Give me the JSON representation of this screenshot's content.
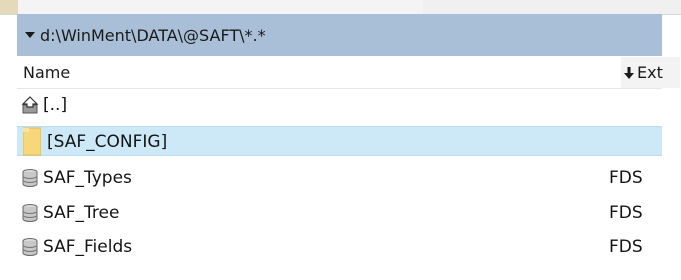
{
  "path_bar": {
    "path": "d:\\WinMent\\DATA\\@SAFT\\*.*"
  },
  "columns": {
    "name": "Name",
    "ext": "Ext"
  },
  "rows": [
    {
      "name": "[..]",
      "ext": "",
      "icon": "up-folder-icon"
    },
    {
      "name": "[SAF_CONFIG]",
      "ext": "",
      "icon": "folder-icon"
    },
    {
      "name": "SAF_Types",
      "ext": "FDS",
      "icon": "database-file-icon"
    },
    {
      "name": "SAF_Tree",
      "ext": "FDS",
      "icon": "database-file-icon"
    },
    {
      "name": "SAF_Fields",
      "ext": "FDS",
      "icon": "database-file-icon"
    }
  ],
  "colors": {
    "path_bar_bg": "#a9bfd7",
    "selected_row_bg": "#cde8f7",
    "folder_yellow": "#f6d77a"
  }
}
